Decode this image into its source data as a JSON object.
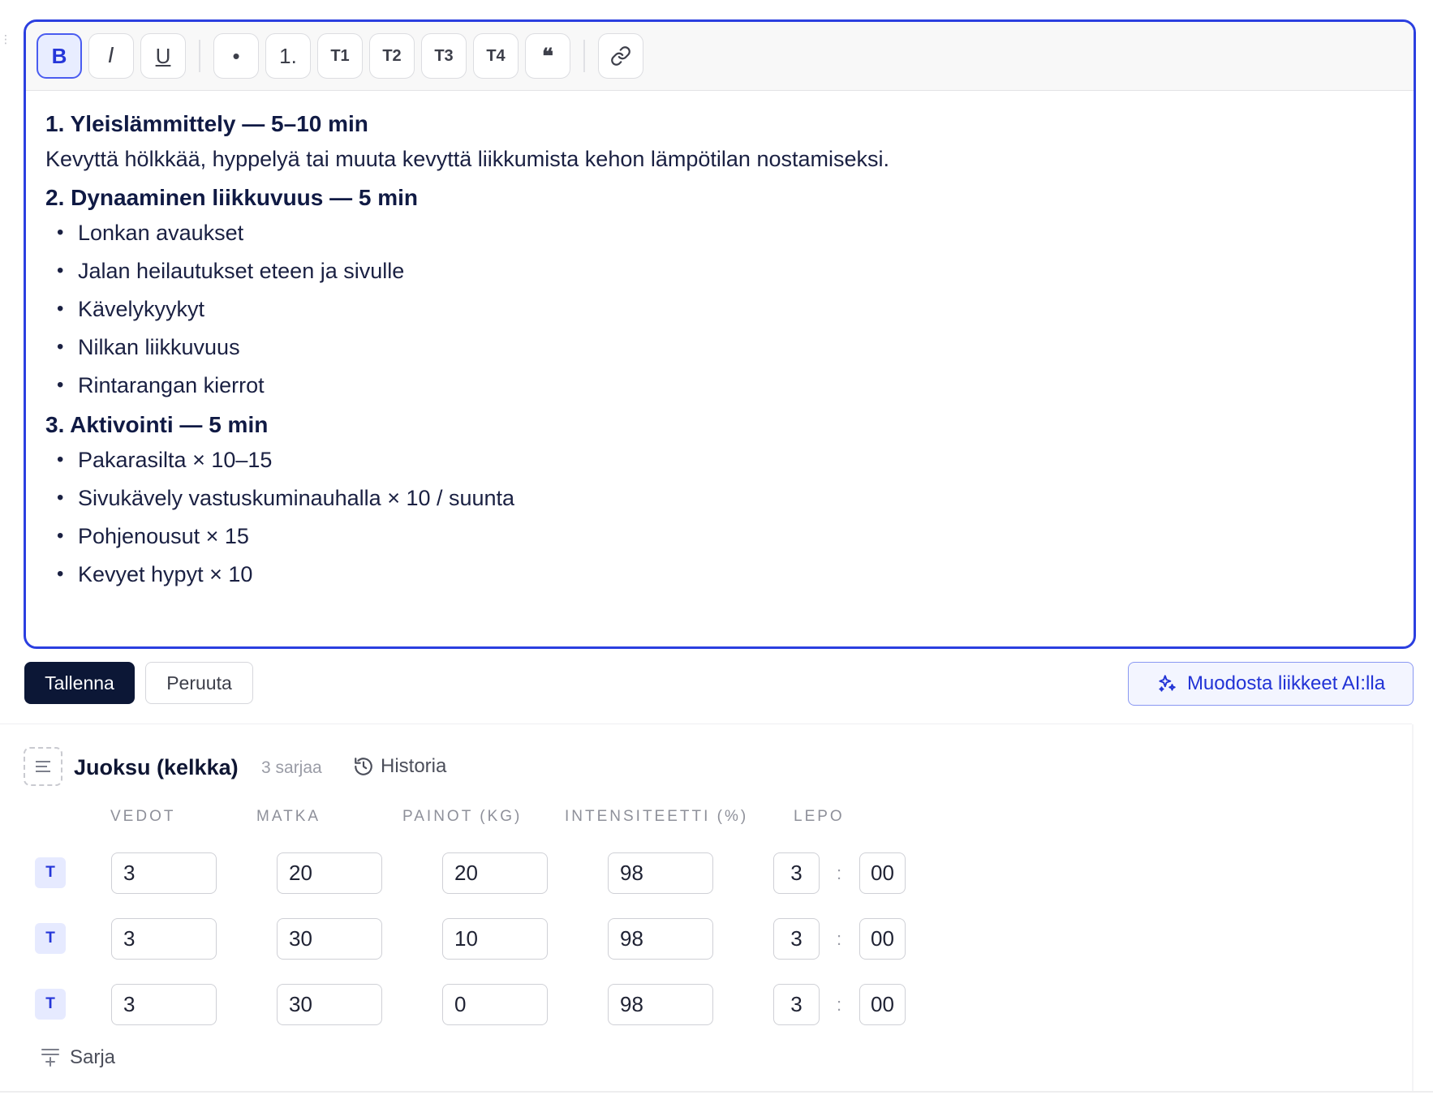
{
  "toolbar": {
    "bold": "B",
    "italic": "I",
    "underline": "U",
    "bullet": "•",
    "numbered": "1.",
    "t1": "T1",
    "t2": "T2",
    "t3": "T3",
    "t4": "T4",
    "quote": "❝",
    "link_icon": "link-icon"
  },
  "content": {
    "section1_heading": "1. Yleislämmittely — 5–10 min",
    "section1_text": "Kevyttä hölkkää, hyppelyä tai muuta kevyttä liikkumista kehon lämpötilan nostamiseksi.",
    "section2_heading": "2. Dynaaminen liikkuvuus — 5 min",
    "section2_items": [
      "Lonkan avaukset",
      "Jalan heilautukset eteen ja sivulle",
      "Kävelykyykyt",
      "Nilkan liikkuvuus",
      "Rintarangan kierrot"
    ],
    "section3_heading": "3. Aktivointi — 5 min",
    "section3_items": [
      "Pakarasilta × 10–15",
      "Sivukävely vastuskuminauhalla × 10 / suunta",
      "Pohjenousut × 15",
      "Kevyet hypyt × 10"
    ]
  },
  "actions": {
    "save": "Tallenna",
    "cancel": "Peruuta",
    "ai": "Muodosta liikkeet AI:lla",
    "ai_icon": "sparkles-icon"
  },
  "exercise": {
    "title": "Juoksu (kelkka)",
    "sets_count": "3 sarjaa",
    "history": "Historia",
    "columns": {
      "reps": "VEDOT",
      "distance": "MATKA",
      "weight": "PAINOT (KG)",
      "intensity": "INTENSITEETTI (%)",
      "rest": "LEPO"
    },
    "rows": [
      {
        "badge": "T",
        "reps": "3",
        "distance": "20",
        "weight": "20",
        "intensity": "98",
        "rest_min": "3",
        "rest_sep": ":",
        "rest_sec": "00"
      },
      {
        "badge": "T",
        "reps": "3",
        "distance": "30",
        "weight": "10",
        "intensity": "98",
        "rest_min": "3",
        "rest_sep": ":",
        "rest_sec": "00"
      },
      {
        "badge": "T",
        "reps": "3",
        "distance": "30",
        "weight": "0",
        "intensity": "98",
        "rest_min": "3",
        "rest_sep": ":",
        "rest_sec": "00"
      }
    ],
    "add_set": "Sarja"
  },
  "colors": {
    "accent": "#2b3fe0",
    "primary_dark": "#0c1736",
    "badge_bg": "#e6eaff"
  }
}
